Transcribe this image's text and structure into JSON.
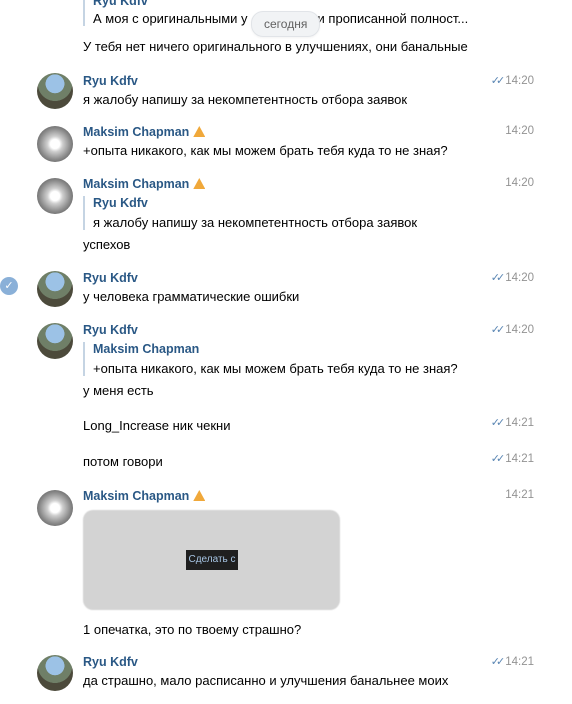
{
  "date_pill": "сегодня",
  "colors": {
    "name_link": "#2a5885",
    "time_gray": "#939393",
    "read_ticks": "#5a86b3"
  },
  "icons": {
    "warning": "warning-triangle-icon",
    "read": "double-check-icon",
    "selected": "check-circle-icon"
  },
  "messages": [
    {
      "type": "continuation",
      "quote_name": "Ryu Kdfv",
      "quote_text": "А моя с оригинальными у",
      "quote_text_tail": "и прописанной полност...",
      "text": "У тебя нет ничего оригинального в улучшениях, они банальные"
    },
    {
      "author": "Ryu Kdfv",
      "time": "14:20",
      "read": true,
      "text": "я жалобу напишу за некомпетентность отбора заявок"
    },
    {
      "author": "Maksim Chapman",
      "warn": true,
      "time": "14:20",
      "text": "+опыта никакого, как мы можем брать тебя куда то не зная?"
    },
    {
      "author": "Maksim Chapman",
      "warn": true,
      "time": "14:20",
      "quote_name": "Ryu Kdfv",
      "quote_text": "я жалобу напишу за некомпетентность отбора заявок",
      "text": "успехов"
    },
    {
      "author": "Ryu Kdfv",
      "time": "14:20",
      "read": true,
      "selected": true,
      "text": "у человека грамматические ошибки"
    },
    {
      "author": "Ryu Kdfv",
      "time": "14:20",
      "read": true,
      "quote_name": "Maksim Chapman",
      "quote_text": "+опыта никакого, как мы можем брать тебя куда то не зная?",
      "text": "у меня есть"
    },
    {
      "type": "continuation",
      "time": "14:21",
      "read": true,
      "text": "Long_Increase ник чекни"
    },
    {
      "type": "continuation",
      "time": "14:21",
      "read": true,
      "text": "потом говори"
    },
    {
      "author": "Maksim Chapman",
      "warn": true,
      "time": "14:21",
      "image_button": "Сделать с",
      "text": "1 опечатка, это по твоему страшно?"
    },
    {
      "author": "Ryu Kdfv",
      "time": "14:21",
      "read": true,
      "text": "да страшно, мало расписанно и улучшения банальнее моих"
    }
  ]
}
